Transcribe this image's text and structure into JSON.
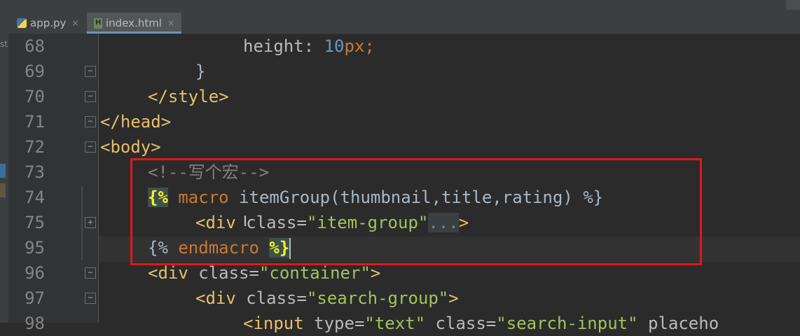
{
  "tabs": [
    {
      "label": "app.py",
      "close": "×",
      "active": false
    },
    {
      "label": "index.html",
      "close": "×",
      "active": true
    }
  ],
  "side_text": "st",
  "lines": [
    {
      "no": "68",
      "indent": 7
    },
    {
      "no": "69",
      "indent": 5
    },
    {
      "no": "70",
      "indent": 3
    },
    {
      "no": "71",
      "indent": 0
    },
    {
      "no": "72",
      "indent": 0
    },
    {
      "no": "73",
      "indent": 3
    },
    {
      "no": "74",
      "indent": 3
    },
    {
      "no": "75",
      "indent": 5
    },
    {
      "no": "95",
      "indent": 3
    },
    {
      "no": "96",
      "indent": 3
    },
    {
      "no": "97",
      "indent": 5
    },
    {
      "no": "98",
      "indent": 7
    }
  ],
  "code": {
    "l68": {
      "a": "height: ",
      "b": "10",
      "c": "px;"
    },
    "l69": "}",
    "l70": "</style>",
    "l71": "</head>",
    "l72": "<body>",
    "l73": "<!--写个宏-->",
    "l74": {
      "open": "{%",
      "kw": "macro",
      "rest": " itemGroup(thumbnail,title,rating) ",
      "close": "%}"
    },
    "l75": {
      "tag_open": "<div",
      "attr": " class=",
      "val": "\"item-group\"",
      "dots": "...",
      "tag_close": ">"
    },
    "l95": {
      "open": "{%",
      "kw": "endmacro",
      "close": "%}"
    },
    "l96": {
      "tag_open": "<div",
      "attr": " class=",
      "val": "\"container\"",
      "tag_close": ">"
    },
    "l97": {
      "tag_open": "<div",
      "attr": " class=",
      "val": "\"search-group\"",
      "tag_close": ">"
    },
    "l98": {
      "tag_open": "<input",
      "attr1": " type=",
      "val1": "\"text\"",
      "attr2": " class=",
      "val2": "\"search-input\"",
      "attr3": " placeho"
    }
  },
  "colors": {
    "background": "#2b2b2b",
    "gutter": "#313335",
    "tag": "#e8bf6a",
    "string": "#a5c25c",
    "number": "#6897bb",
    "keyword": "#cc7832",
    "comment": "#808080",
    "highlight_box": "#e01818"
  }
}
